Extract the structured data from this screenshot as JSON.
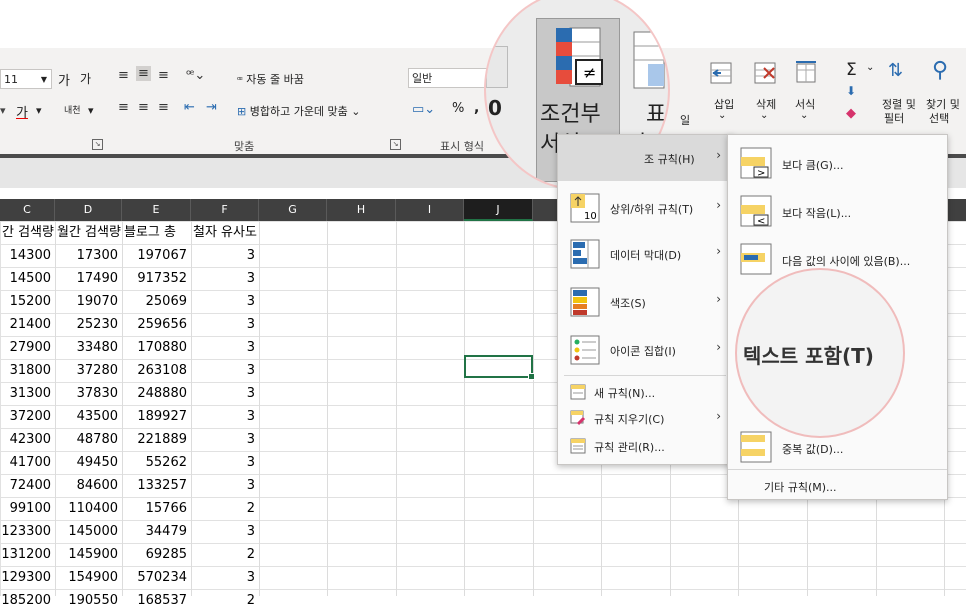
{
  "ribbon": {
    "font_size": "11",
    "grow_font": "가",
    "shrink_font": "가",
    "bold_underline": "가",
    "phonetic": "내천",
    "wrap_text": "자동 줄 바꿈",
    "merge_center": "병합하고 가운데 맞춤",
    "number_format": "일반",
    "percent": "%",
    "comma": ",",
    "alignment_group": "맞춤",
    "number_group": "표시 형식",
    "insert": "삽입",
    "delete": "삭제",
    "format": "서식",
    "sort_filter_l1": "정렬 및",
    "sort_filter_l2": "필터",
    "find_select_l1": "찾기 및",
    "find_select_l2": "선택",
    "table_format_partial": "일",
    "sigma": "Σ"
  },
  "magnifier": {
    "cf_line1": "조건부",
    "cf_line2": "서식",
    "table_line1": "표",
    "table_line2": "서",
    "zero": "0"
  },
  "columns": [
    "C",
    "D",
    "E",
    "F",
    "G",
    "H",
    "I",
    "J"
  ],
  "sheet": {
    "headers": [
      "간 검색량",
      "월간 검색량",
      "블로그 총",
      "철자 유사도"
    ],
    "rows": [
      [
        "14300",
        "17300",
        "197067",
        "3"
      ],
      [
        "14500",
        "17490",
        "917352",
        "3"
      ],
      [
        "15200",
        "19070",
        "25069",
        "3"
      ],
      [
        "21400",
        "25230",
        "259656",
        "3"
      ],
      [
        "27900",
        "33480",
        "170880",
        "3"
      ],
      [
        "31800",
        "37280",
        "263108",
        "3"
      ],
      [
        "31300",
        "37830",
        "248880",
        "3"
      ],
      [
        "37200",
        "43500",
        "189927",
        "3"
      ],
      [
        "42300",
        "48780",
        "221889",
        "3"
      ],
      [
        "41700",
        "49450",
        "55262",
        "3"
      ],
      [
        "72400",
        "84600",
        "133257",
        "3"
      ],
      [
        "99100",
        "110400",
        "15766",
        "2"
      ],
      [
        "123300",
        "145000",
        "34479",
        "3"
      ],
      [
        "131200",
        "145900",
        "69285",
        "2"
      ],
      [
        "129300",
        "154900",
        "570234",
        "3"
      ],
      [
        "185200",
        "190550",
        "168537",
        "2"
      ]
    ]
  },
  "menu": {
    "highlight_rules": "조 규칙(H)",
    "top_bottom": "상위/하위 규칙(T)",
    "data_bars": "데이터 막대(D)",
    "color_scales": "색조(S)",
    "icon_sets": "아이콘 집합(I)",
    "new_rule": "새 규칙(N)...",
    "clear_rules": "규칙 지우기(C)",
    "manage_rules": "규칙 관리(R)...",
    "icon_ten": "10"
  },
  "submenu": {
    "greater_than": "보다 큼(G)...",
    "less_than": "보다 작음(L)...",
    "between": "다음 값의 사이에 있음(B)...",
    "text_contains": "텍스트 포함(T)",
    "duplicate": "중복 값(D)...",
    "more_rules": "기타 규칙(M)..."
  },
  "colors": {
    "excel_green": "#217346",
    "header_dark": "#404040",
    "pink_ring": "#f0bcbc"
  }
}
